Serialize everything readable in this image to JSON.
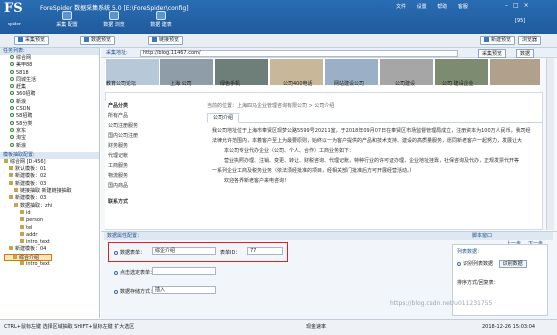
{
  "titlebar": {
    "logo": "FS",
    "logo_sub": "spider",
    "title": "ForeSpider 数据采集系统  5.0  [E:\\ForeSpider\\config]",
    "buttons": [
      {
        "label": "采集\n配置"
      },
      {
        "label": "数据\n浏览"
      },
      {
        "label": "数据\n建表"
      }
    ],
    "menus": [
      "文件",
      "设置",
      "帮助",
      "客服"
    ],
    "count": "[95]"
  },
  "toolbar": {
    "collect_preview": "采集预览",
    "data_preview": "数据预览",
    "chain_preview": "链接预览",
    "new_label": "新建预览",
    "browser_label": "浏览器"
  },
  "left_panel": {
    "task_list_title": "任务列表:",
    "tasks": [
      "综合网",
      "美甲88",
      "5818",
      "同城生活",
      "赶集",
      "360招聘",
      "新浪",
      "CSDN",
      "58招聘",
      "58分类",
      "京东",
      "淘宝",
      "新浪"
    ],
    "tree_title": "模板抽取配置:",
    "tree": [
      "综合网 [D:456]",
      "默认模板：01",
      "新建模板：02",
      "新建模板：03",
      "链接抽取 新建链接抽取",
      "新建模板：03",
      "数据抽取：zhi",
      "id",
      "person",
      "tel",
      "addr",
      "intro_text",
      "新建模板：04",
      "综合介绍",
      "intro_text"
    ]
  },
  "url_bar": {
    "label": "采集地址:",
    "url": "http://blog.11467.com/",
    "btn1": "采集预览",
    "btn2": "数据"
  },
  "strip": [
    "教育公司论坛",
    "上海 公司",
    "绿色手机",
    "公司400电话",
    "网站建设公司",
    "公司建设",
    "公司 建设企业"
  ],
  "website": {
    "sidebar_title": "产品分类",
    "sidebar_items": [
      "所有产品",
      "公司注册服务",
      "国内公司注册",
      "财务服务",
      "代理记帐",
      "工商服务",
      "物流服务",
      "国内商品",
      "",
      "联系方式"
    ],
    "breadcrumb": "当前的位置：上海四马企业管理咨询有限公司 > 公司介绍",
    "tab": "公司介绍",
    "intro_lines": [
      "我公司地址位于上海市奉贤区现梦公路5599号20211室，于2018年09月07日在奉贤区市场监督管理局成立，注册资本为100万人民币，我司经",
      "法律允许范围内，本着客户至上为最要原则，始终以一为客户提供的产品和技术支持、建设的高质量服务，愿同新老客户一起努力，发展让大",
      "本公司专业代办企业（公司、个人、合作）工商业务如下：",
      "营业执照办理、注销、变更、转让、财税咨询、代理记账，特种行业的许可证办理，企业地址挂靠，社保咨询及代办，正规发票代开等",
      "一系列企业工商及税务业务（依法须经批准的项目，经相关部门批准后方可开展经营活动。）",
      "欢迎各界新老客户来电咨询！"
    ]
  },
  "config": {
    "title": "数据属性配置：",
    "data_table_label": "数据表单：",
    "data_table_value": "综企介绍",
    "table_id_label": "表单ID：",
    "table_id_value": "77",
    "collect_label": "点击选定表单：",
    "collect_value": "",
    "store_label": "数据存储方式：",
    "store_value": "插入",
    "right_top": "脚本窗口",
    "right_prev": "上一步",
    "right_next": "下一步",
    "list_title": "列表数据：",
    "list_item1": "识别列表数据",
    "list_btn": "识别数据",
    "sort_label": "排序方式/回复表：",
    "watermark": "https://blog.csdn.net/u011231755"
  },
  "status": {
    "left": "CTRL+鼠标左键  选择区域抽取    SHIFT+鼠标左键  扩大选区",
    "right": "2018-12-26 15:03:04",
    "mid": "现金速率"
  }
}
